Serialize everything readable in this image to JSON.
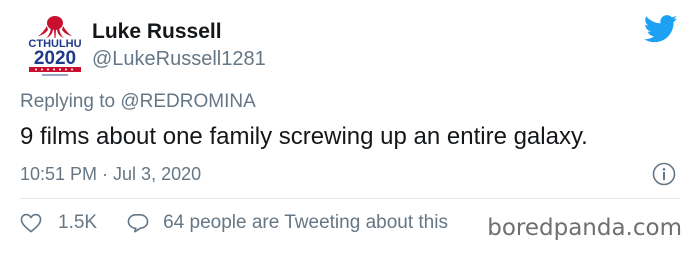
{
  "author": {
    "name": "Luke Russell",
    "handle": "@LukeRussell1281",
    "avatar_text_top": "CTHULHU",
    "avatar_text_year": "2020"
  },
  "reply": {
    "prefix": "Replying to ",
    "mention": "@REDROMINA"
  },
  "tweet": {
    "text": "9 films about one family screwing up an entire galaxy."
  },
  "meta": {
    "timestamp": "10:51 PM · Jul 3, 2020"
  },
  "actions": {
    "likes": "1.5K",
    "conversation": "64 people are Tweeting about this"
  },
  "watermark": "boredpanda.com",
  "icons": {
    "bird": "twitter-bird-icon",
    "info": "info-icon",
    "like": "heart-icon",
    "reply": "speech-bubble-icon"
  },
  "colors": {
    "brand": "#1da1f2",
    "secondary_text": "#657786",
    "primary_text": "#14171a",
    "avatar_red": "#c8102e",
    "avatar_blue": "#1f3a8a"
  }
}
